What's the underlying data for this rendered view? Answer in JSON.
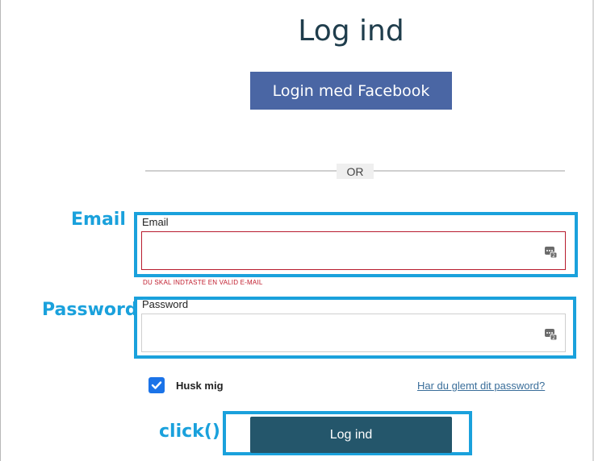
{
  "page": {
    "title": "Log ind"
  },
  "facebook_button": {
    "label": "Login med Facebook"
  },
  "divider": {
    "or_text": "OR"
  },
  "annotations": {
    "email": "Email",
    "password": "Password",
    "click": "click()"
  },
  "form": {
    "email_label": "Email",
    "email_value": "",
    "email_error": "DU SKAL INDTASTE EN VALID E-MAIL",
    "password_label": "Password",
    "password_value": "",
    "remember_label": "Husk mig",
    "remember_checked": true,
    "forgot_link": "Har du glemt dit password?",
    "submit_label": "Log ind"
  },
  "colors": {
    "facebook": "#4a66a4",
    "submit": "#24566b",
    "annotation": "#1aa1dc",
    "error": "#c01d2e",
    "checkbox": "#1b73e8"
  },
  "icons": {
    "password_manager": "password-manager-icon",
    "checkmark": "checkmark-icon"
  }
}
